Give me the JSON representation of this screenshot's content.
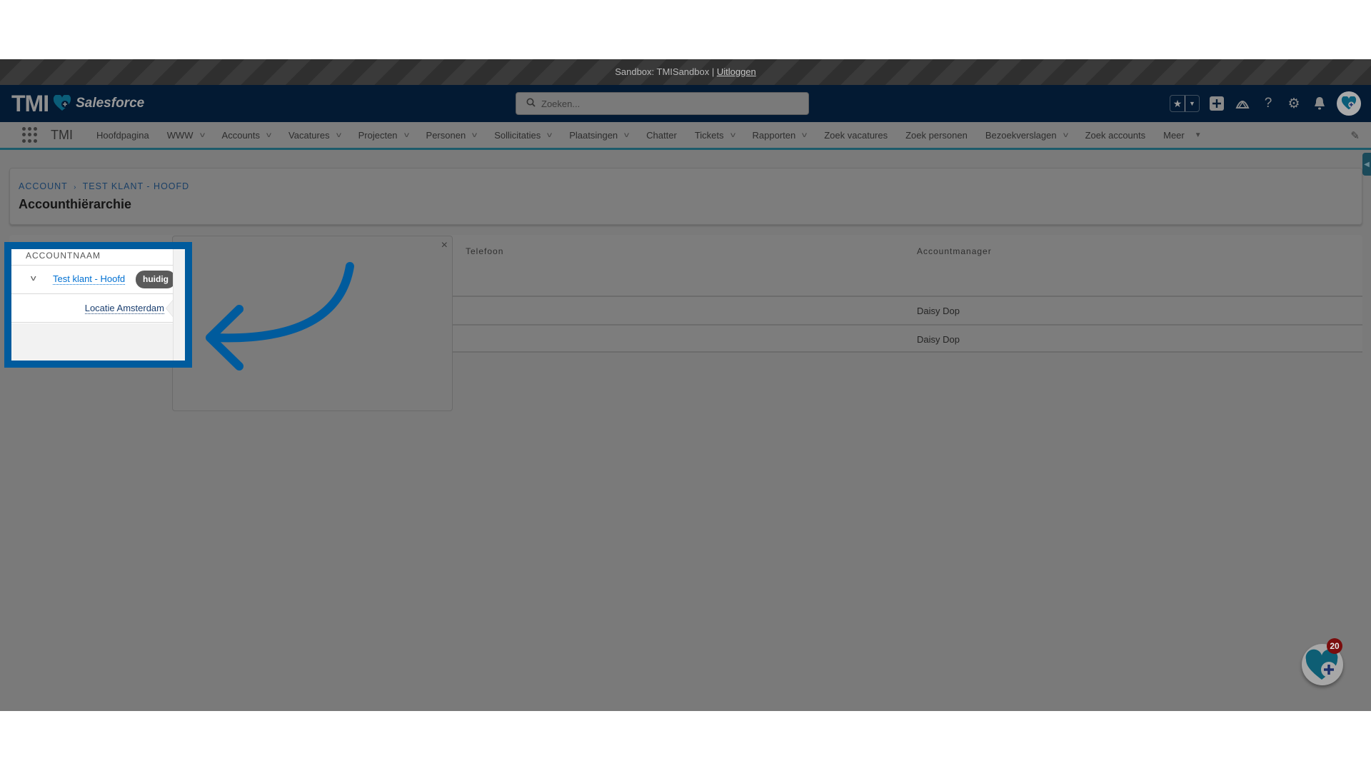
{
  "sandbox_bar": {
    "text": "Sandbox: TMISandbox | ",
    "logout_label": "Uitloggen"
  },
  "header": {
    "logo_text": "TMI",
    "logo_sub": "Salesforce",
    "search_placeholder": "Zoeken...",
    "icons": [
      "favorites-star-icon",
      "favorites-dropdown-icon",
      "global-actions-add-icon",
      "trailhead-icon",
      "help-icon",
      "setup-gear-icon",
      "notifications-bell-icon",
      "user-avatar"
    ]
  },
  "nav": {
    "app_name": "TMI",
    "items": [
      {
        "label": "Hoofdpagina",
        "has_dropdown": false
      },
      {
        "label": "WWW",
        "has_dropdown": true
      },
      {
        "label": "Accounts",
        "has_dropdown": true
      },
      {
        "label": "Vacatures",
        "has_dropdown": true
      },
      {
        "label": "Projecten",
        "has_dropdown": true
      },
      {
        "label": "Personen",
        "has_dropdown": true
      },
      {
        "label": "Sollicitaties",
        "has_dropdown": true
      },
      {
        "label": "Plaatsingen",
        "has_dropdown": true
      },
      {
        "label": "Chatter",
        "has_dropdown": false
      },
      {
        "label": "Tickets",
        "has_dropdown": true
      },
      {
        "label": "Rapporten",
        "has_dropdown": true
      },
      {
        "label": "Zoek vacatures",
        "has_dropdown": false
      },
      {
        "label": "Zoek personen",
        "has_dropdown": false
      },
      {
        "label": "Bezoekverslagen",
        "has_dropdown": true
      },
      {
        "label": "Zoek accounts",
        "has_dropdown": false
      },
      {
        "label": "Meer",
        "has_dropdown": true
      }
    ]
  },
  "page": {
    "breadcrumb": [
      "Account",
      "Test klant - Hoofd"
    ],
    "breadcrumb_sep": "›",
    "title": "Accounthiërarchie"
  },
  "table": {
    "columns": [
      "Accountnaam",
      "Telefoon",
      "Accountmanager"
    ],
    "rows": [
      {
        "name": "Test klant - Hoofd",
        "badge": "huidig",
        "phone": "",
        "manager": "Daisy Dop"
      },
      {
        "name": "Locatie Amsterdam",
        "badge": "",
        "phone": "",
        "manager": "Daisy Dop"
      }
    ]
  },
  "popover": {
    "close_label": "×"
  },
  "fab": {
    "badge_count": "20"
  },
  "colors": {
    "highlight": "#005b9d",
    "header_bg": "#031a33",
    "link": "#0070d2",
    "badge_bg": "#5a5a5a",
    "notification": "#7a0d0d"
  }
}
